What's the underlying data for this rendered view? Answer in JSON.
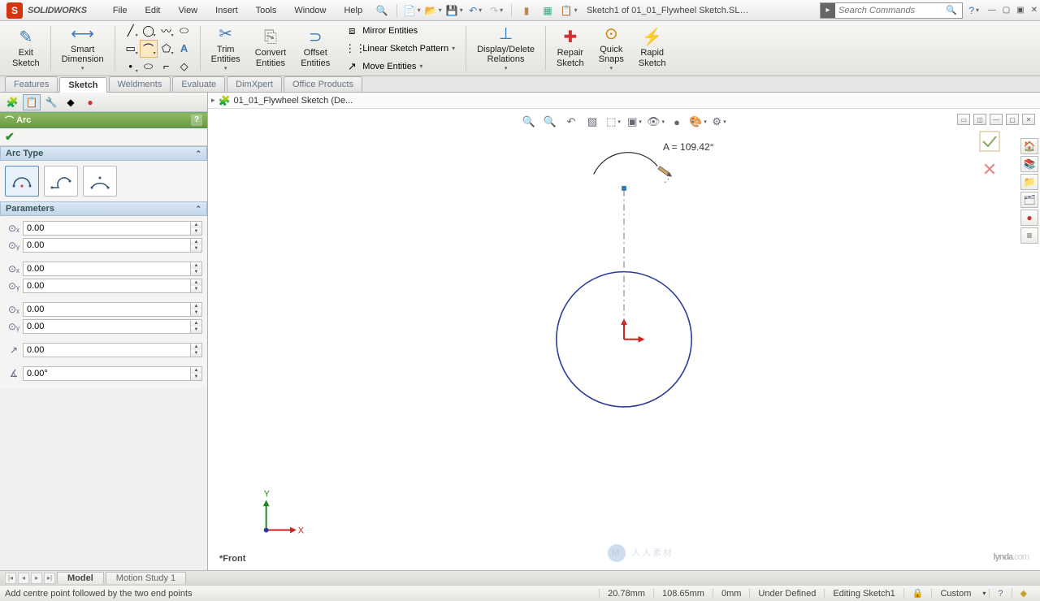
{
  "app": {
    "name": "SOLIDWORKS",
    "doc_title": "Sketch1 of 01_01_Flywheel Sketch.SLD..."
  },
  "menu": {
    "file": "File",
    "edit": "Edit",
    "view": "View",
    "insert": "Insert",
    "tools": "Tools",
    "window": "Window",
    "help": "Help"
  },
  "search": {
    "placeholder": "Search Commands"
  },
  "ribbon": {
    "exit_sketch": "Exit\nSketch",
    "smart_dimension": "Smart\nDimension",
    "trim": "Trim\nEntities",
    "convert": "Convert\nEntities",
    "offset": "Offset\nEntities",
    "mirror": "Mirror Entities",
    "linear": "Linear Sketch Pattern",
    "move": "Move Entities",
    "display_delete": "Display/Delete\nRelations",
    "repair": "Repair\nSketch",
    "quick_snaps": "Quick\nSnaps",
    "rapid_sketch": "Rapid\nSketch"
  },
  "tabs": {
    "features": "Features",
    "sketch": "Sketch",
    "weldments": "Weldments",
    "evaluate": "Evaluate",
    "dimxpert": "DimXpert",
    "office": "Office Products"
  },
  "fm": {
    "name": "01_01_Flywheel Sketch  (De..."
  },
  "pm": {
    "title": "Arc",
    "sec_arc_type": "Arc Type",
    "sec_parameters": "Parameters",
    "params": {
      "cx": "0.00",
      "cy": "0.00",
      "sx": "0.00",
      "sy": "0.00",
      "ex": "0.00",
      "ey": "0.00",
      "r": "0.00",
      "a": "0.00°"
    }
  },
  "readout": {
    "angle": "A = 109.42°"
  },
  "view_label": "*Front",
  "btm_tabs": {
    "model": "Model",
    "motion": "Motion Study 1"
  },
  "status": {
    "hint": "Add centre point followed by the two end points",
    "x": "20.78mm",
    "y": "108.65mm",
    "z": "0mm",
    "def": "Under Defined",
    "editing": "Editing Sketch1",
    "custom": "Custom"
  },
  "watermark": {
    "lynda": "lynda",
    "dotcom": ".com",
    "cn": "人人素材"
  }
}
